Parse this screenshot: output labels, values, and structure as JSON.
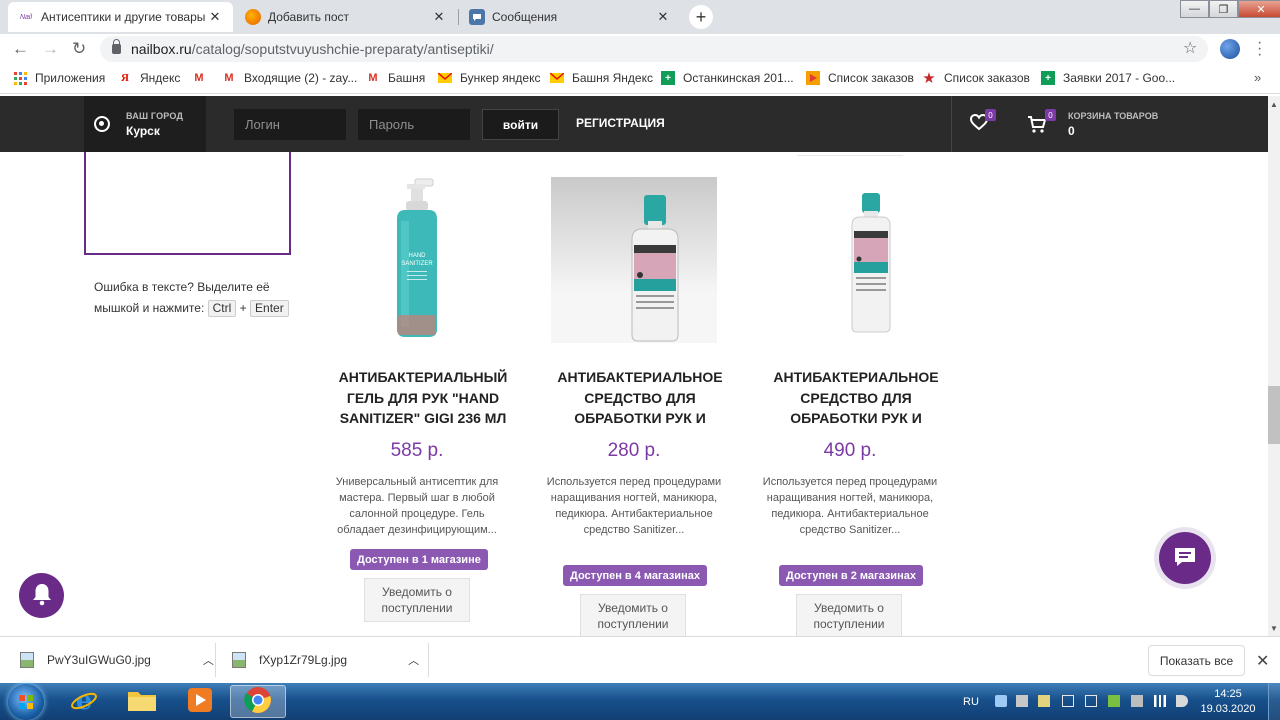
{
  "browser": {
    "tabs": [
      {
        "title": "Антисептики и другие товары д",
        "active": true
      },
      {
        "title": "Добавить пост",
        "active": false
      },
      {
        "title": "Сообщения",
        "active": false
      }
    ],
    "url_host": "nailbox.ru",
    "url_path": "/catalog/soputstvuyushchie-preparaty/antiseptiki/",
    "bookmarks": [
      "Приложения",
      "Яндекс",
      "",
      "Входящие (2) - zay...",
      "Башня",
      "Бункер яндекс",
      "Башня Яндекс",
      "Останкинская 201...",
      "Список заказов",
      "Список заказов",
      "Заявки 2017 - Goo..."
    ]
  },
  "header": {
    "city_label": "ВАШ ГОРОД",
    "city_value": "Курск",
    "login_placeholder": "Логин",
    "password_placeholder": "Пароль",
    "login_button": "войти",
    "register_link": "РЕГИСТРАЦИЯ",
    "favorites_count": "0",
    "cart_count": "0",
    "cart_label": "КОРЗИНА ТОВАРОВ",
    "cart_value": "0"
  },
  "sidebar": {
    "typo_text": "Ошибка в тексте? Выделите её мышкой и нажмите:",
    "key_ctrl": "Ctrl",
    "plus": "+",
    "key_enter": "Enter"
  },
  "products": [
    {
      "title": "АНТИБАКТЕРИАЛЬНЫЙ ГЕЛЬ ДЛЯ РУК \"HAND SANITIZER\" GIGI 236 МЛ",
      "price": "585 р.",
      "description": "Универсальный антисептик для мастера. Первый шаг в любой салонной процедуре. Гель обладает дезинфицирующим...",
      "availability": "Доступен в 1 магазине",
      "notify_button": "Уведомить о поступлении"
    },
    {
      "title": "АНТИБАКТЕРИАЛЬНОЕ СРЕДСТВО ДЛЯ ОБРАБОТКИ РУК И",
      "price": "280 р.",
      "description": "Используется перед процедурами наращивания ногтей, маникюра, педикюра. Антибактериальное средство Sanitizer...",
      "availability": "Доступен в 4 магазинах",
      "notify_button": "Уведомить о поступлении"
    },
    {
      "title": "АНТИБАКТЕРИАЛЬНОЕ СРЕДСТВО ДЛЯ ОБРАБОТКИ РУК И",
      "price": "490 р.",
      "description": "Используется перед процедурами наращивания ногтей, маникюра, педикюра. Антибактериальное средство Sanitizer...",
      "availability": "Доступен в 2 магазинах",
      "notify_button": "Уведомить о поступлении"
    }
  ],
  "downloads": {
    "items": [
      "PwY3uIGWuG0.jpg",
      "fXyp1Zr79Lg.jpg"
    ],
    "show_all": "Показать все"
  },
  "taskbar": {
    "language": "RU",
    "time": "14:25",
    "date": "19.03.2020"
  },
  "colors": {
    "brand_purple": "#7b3aa6",
    "header_dark": "#2b2b2b",
    "availability_badge": "#8b59b2"
  },
  "icons": [
    "location-pin-icon",
    "heart-icon",
    "cart-icon",
    "bell-icon",
    "chat-icon",
    "lock-icon",
    "star-icon",
    "back-icon",
    "forward-icon",
    "reload-icon"
  ]
}
